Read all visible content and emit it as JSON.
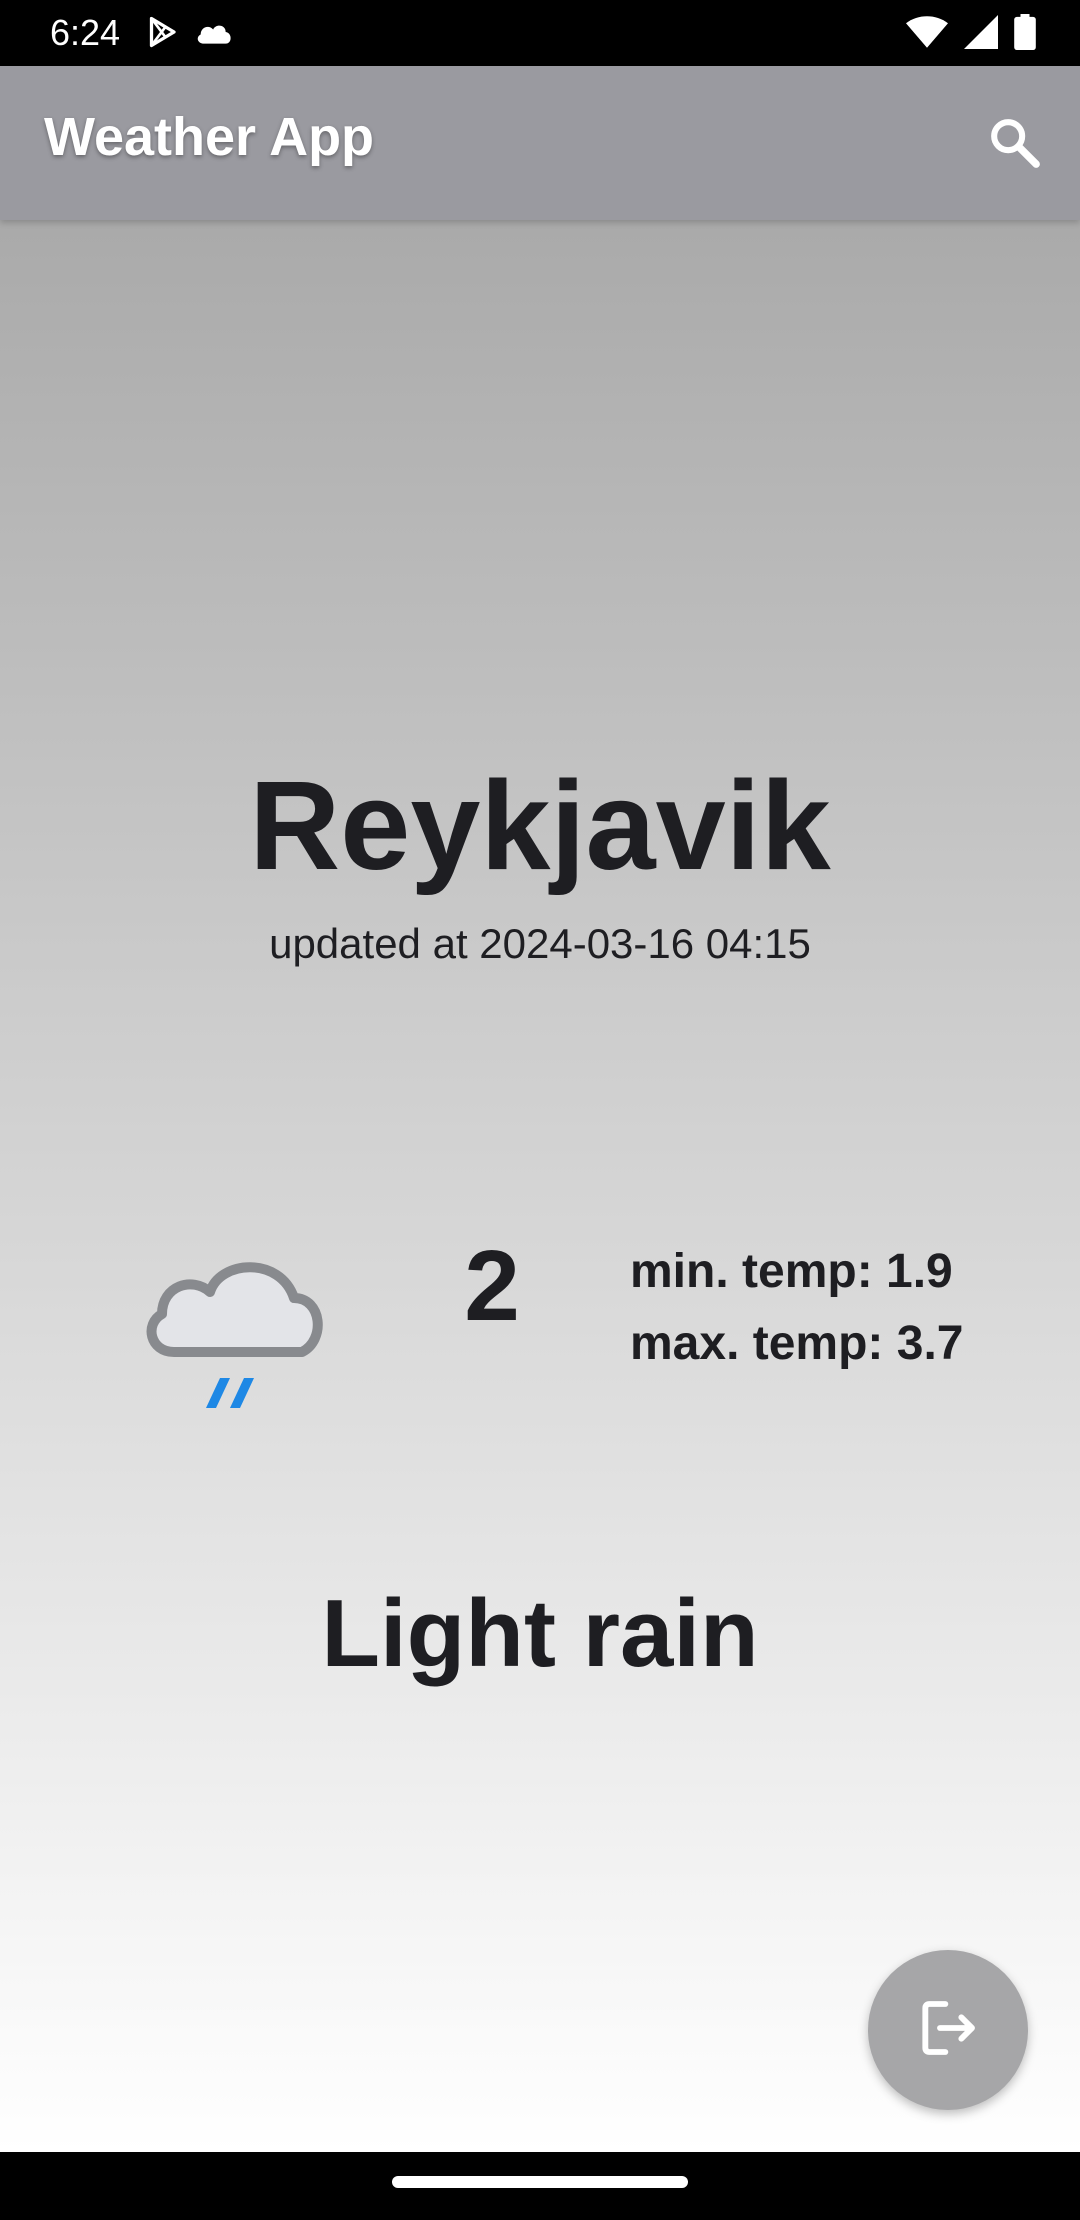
{
  "status_bar": {
    "time": "6:24",
    "left_icons": [
      "play-store-icon",
      "cloud-icon"
    ],
    "right_icons": [
      "wifi-icon",
      "cellular-signal-icon",
      "battery-icon"
    ]
  },
  "app_bar": {
    "title": "Weather App",
    "action_icon": "search-icon",
    "background_color": "#9a9aa0"
  },
  "weather": {
    "city": "Reykjavik",
    "updated": "updated at 2024-03-16 04:15",
    "icon": "light-rain-icon",
    "temperature": "2",
    "min_temp": "min. temp: 1.9",
    "max_temp": "max. temp: 3.7",
    "description": "Light rain"
  },
  "fab": {
    "icon": "logout-icon",
    "color": "#a6a6a8"
  },
  "colors": {
    "text_primary": "#1e1e22",
    "rain_accent": "#1e88e5",
    "gradient_top": "#a3a3a3",
    "gradient_bottom": "#ffffff"
  }
}
